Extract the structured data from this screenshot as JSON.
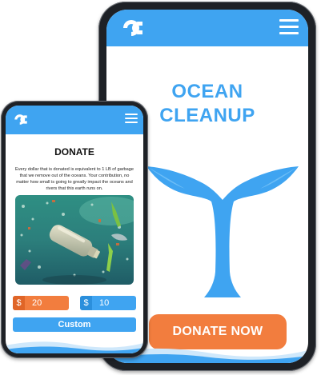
{
  "colors": {
    "brand_blue": "#3fa4f1",
    "accent_orange": "#f27d3e",
    "phone_frame": "#1e2126"
  },
  "large_phone": {
    "logo_icon": "oc-logo-icon",
    "menu_icon": "hamburger-menu-icon",
    "title_line1": "OCEAN",
    "title_line2": "CLEANUP",
    "illustration": "whale-tail-illustration",
    "cta_label": "DONATE NOW"
  },
  "small_phone": {
    "logo_icon": "oc-logo-icon",
    "menu_icon": "hamburger-menu-icon",
    "title": "DONATE",
    "description": "Every dollar that is donated is equivalent to 1 LB of garbage that we remove out of the oceans. Your contribution, no matter how small is going to greatly impact the oceans and rivers that this earth runs on.",
    "photo": "ocean-plastic-pollution-photo",
    "amounts": [
      {
        "currency": "$",
        "value": "20"
      },
      {
        "currency": "$",
        "value": "10"
      }
    ],
    "custom_label": "Custom"
  }
}
